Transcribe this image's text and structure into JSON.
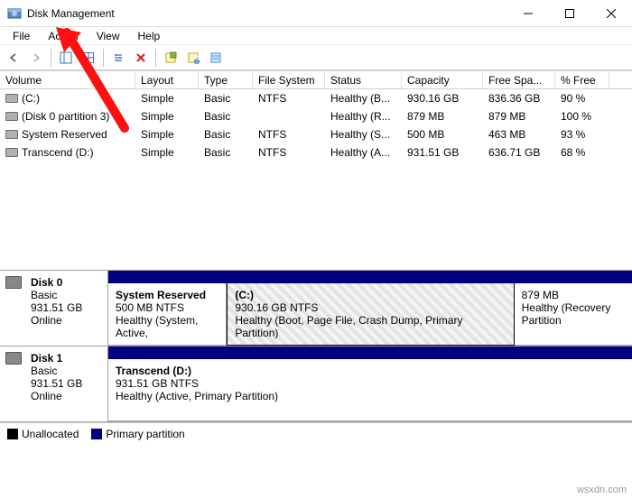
{
  "window": {
    "title": "Disk Management"
  },
  "menu": {
    "file": "File",
    "action": "Action",
    "view": "View",
    "help": "Help"
  },
  "columns": {
    "volume": "Volume",
    "layout": "Layout",
    "type": "Type",
    "fs": "File System",
    "status": "Status",
    "capacity": "Capacity",
    "free": "Free Spa...",
    "pfree": "% Free"
  },
  "volumes": [
    {
      "name": "(C:)",
      "layout": "Simple",
      "type": "Basic",
      "fs": "NTFS",
      "status": "Healthy (B...",
      "capacity": "930.16 GB",
      "free": "836.36 GB",
      "pfree": "90 %"
    },
    {
      "name": "(Disk 0 partition 3)",
      "layout": "Simple",
      "type": "Basic",
      "fs": "",
      "status": "Healthy (R...",
      "capacity": "879 MB",
      "free": "879 MB",
      "pfree": "100 %"
    },
    {
      "name": "System Reserved",
      "layout": "Simple",
      "type": "Basic",
      "fs": "NTFS",
      "status": "Healthy (S...",
      "capacity": "500 MB",
      "free": "463 MB",
      "pfree": "93 %"
    },
    {
      "name": "Transcend (D:)",
      "layout": "Simple",
      "type": "Basic",
      "fs": "NTFS",
      "status": "Healthy (A...",
      "capacity": "931.51 GB",
      "free": "636.71 GB",
      "pfree": "68 %"
    }
  ],
  "disks": [
    {
      "name": "Disk 0",
      "type": "Basic",
      "size": "931.51 GB",
      "state": "Online",
      "partitions": [
        {
          "title": "System Reserved",
          "sub1": "500 MB NTFS",
          "sub2": "Healthy (System, Active,",
          "flex": "1.6",
          "selected": false
        },
        {
          "title": "(C:)",
          "sub1": "930.16 GB NTFS",
          "sub2": "Healthy (Boot, Page File, Crash Dump, Primary Partition)",
          "flex": "4.2",
          "selected": true
        },
        {
          "title": "",
          "sub1": "879 MB",
          "sub2": "Healthy (Recovery Partition",
          "flex": "1.6",
          "selected": false
        }
      ]
    },
    {
      "name": "Disk 1",
      "type": "Basic",
      "size": "931.51 GB",
      "state": "Online",
      "partitions": [
        {
          "title": "Transcend (D:)",
          "sub1": "931.51 GB NTFS",
          "sub2": "Healthy (Active, Primary Partition)",
          "flex": "1",
          "selected": false
        }
      ]
    }
  ],
  "legend": {
    "unalloc": "Unallocated",
    "primary": "Primary partition"
  },
  "watermark": "wsxdn.com"
}
